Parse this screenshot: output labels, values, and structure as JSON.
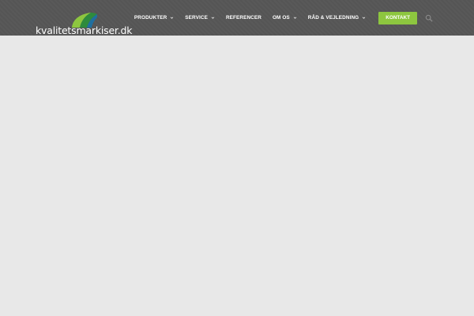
{
  "brand": {
    "logo_text": "kvalitetsmarkiser.dk",
    "colors": {
      "header_bg": "#555555",
      "accent": "#8dc63f",
      "page_bg": "#e8e8e8"
    }
  },
  "nav": {
    "items": [
      {
        "label": "PRODUKTER",
        "dropdown": true
      },
      {
        "label": "SERVICE",
        "dropdown": true
      },
      {
        "label": "REFERENCER",
        "dropdown": false
      },
      {
        "label": "OM OS",
        "dropdown": true
      },
      {
        "label": "RÅD & VEJLEDNING",
        "dropdown": true
      }
    ],
    "cta_label": "KONTAKT",
    "icons": {
      "dropdown": "chevron-down-icon",
      "search": "search-icon"
    }
  }
}
